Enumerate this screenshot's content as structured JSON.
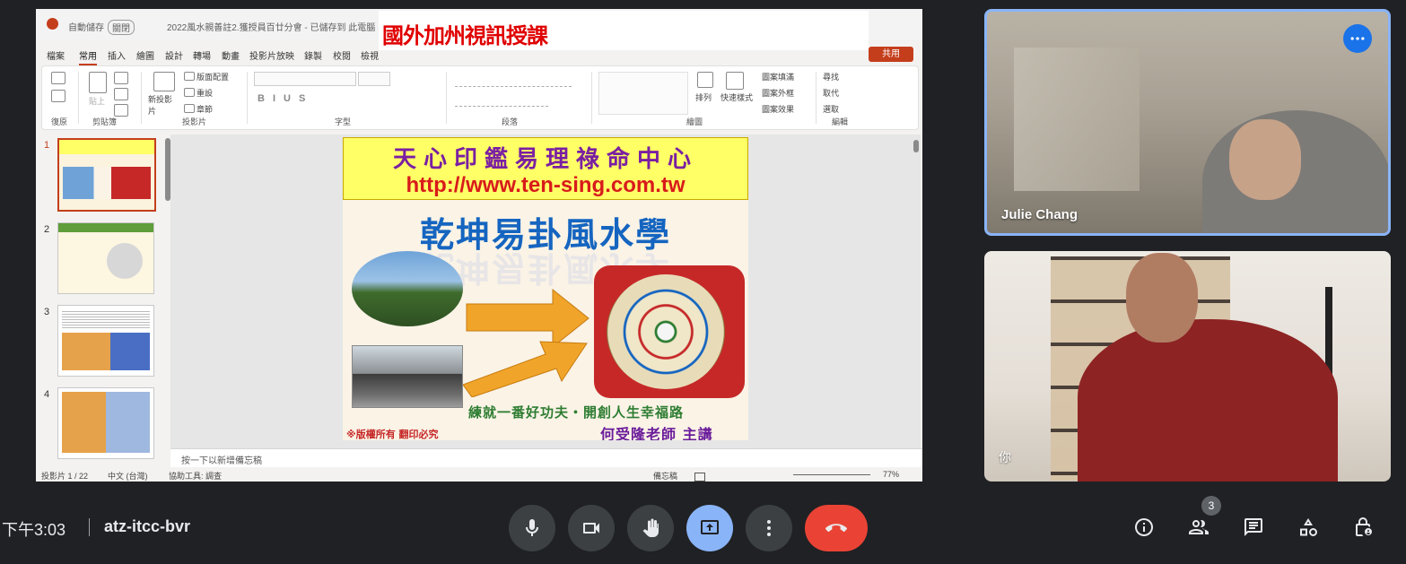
{
  "share": {
    "ppt_title": "2022風水親善註2.獲授員百廿分會 - 已儲存到 此電腦",
    "autosave": "自動儲存",
    "autosave_state": "關閉",
    "overlay_caption": "國外加州視訊授課",
    "share_label": "共用",
    "tabs": [
      "檔案",
      "常用",
      "插入",
      "繪圖",
      "設計",
      "轉場",
      "動畫",
      "投影片放映",
      "錄製",
      "校閱",
      "檢視"
    ],
    "active_tab": "常用",
    "ribbon_groups": [
      "復原",
      "剪貼簿",
      "投影片",
      "字型",
      "段落",
      "繪圖",
      "編輯"
    ],
    "ribbon_labels": {
      "paste": "貼上",
      "new_slide": "新投影片",
      "layout": "版面配置",
      "reset": "重設",
      "section": "章節",
      "arrange": "排列",
      "quick_styles": "快速樣式",
      "shape_fill": "圖案填滿",
      "shape_outline": "圖案外框",
      "shape_effects": "圖案效果",
      "find": "尋找",
      "replace": "取代",
      "select": "選取"
    },
    "thumb_numbers": [
      "1",
      "2",
      "3",
      "4"
    ],
    "notes_placeholder": "按一下以新增備忘稿",
    "status": {
      "slide_count": "投影片 1 / 22",
      "language": "中文 (台灣)",
      "accessibility": "協助工具: 調查",
      "notes": "備忘稿",
      "zoom": "77%"
    }
  },
  "slide": {
    "org": "天心印鑑易理祿命中心",
    "url": "http://www.ten-sing.com.tw",
    "title": "乾坤易卦風水學",
    "motto": "練就一番好功夫・開創人生幸福路",
    "copyright": "※版權所有  翻印必究",
    "teacher": "何受隆老師 主講"
  },
  "participants": [
    {
      "name": "Julie Chang"
    },
    {
      "name": "你"
    }
  ],
  "bottom_bar": {
    "time": "下午3:03",
    "meeting_code": "atz-itcc-bvr",
    "people_count": "3"
  },
  "colors": {
    "background": "#202124",
    "present_active": "#8ab4f8",
    "leave": "#ea4335",
    "speaker_border": "#8ab4f8"
  }
}
